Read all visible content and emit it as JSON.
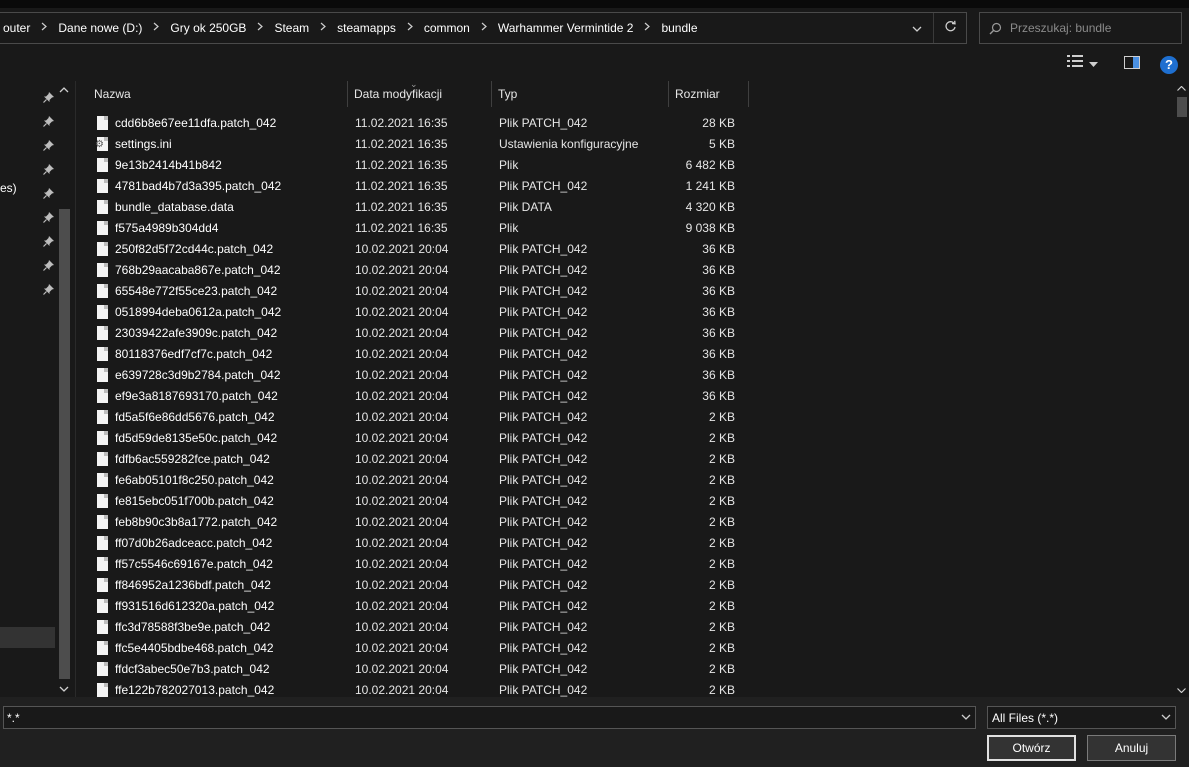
{
  "address": {
    "breadcrumbs": [
      "outer",
      "Dane nowe (D:)",
      "Gry ok 250GB",
      "Steam",
      "steamapps",
      "common",
      "Warhammer Vermintide 2",
      "bundle"
    ]
  },
  "search": {
    "placeholder": "Przeszukaj: bundle"
  },
  "nav": {
    "label_fragment": "es)"
  },
  "columns": {
    "name": "Nazwa",
    "date": "Data modyfikacji",
    "type": "Typ",
    "size": "Rozmiar"
  },
  "files": [
    {
      "name": "cdd6b8e67ee11dfa.patch_042",
      "date": "11.02.2021 16:35",
      "type": "Plik PATCH_042",
      "size": "28 KB",
      "icon": "file-icon"
    },
    {
      "name": "settings.ini",
      "date": "11.02.2021 16:35",
      "type": "Ustawienia konfiguracyjne",
      "size": "5 KB",
      "icon": "settings-file-icon"
    },
    {
      "name": "9e13b2414b41b842",
      "date": "11.02.2021 16:35",
      "type": "Plik",
      "size": "6 482 KB",
      "icon": "file-icon"
    },
    {
      "name": "4781bad4b7d3a395.patch_042",
      "date": "11.02.2021 16:35",
      "type": "Plik PATCH_042",
      "size": "1 241 KB",
      "icon": "file-icon"
    },
    {
      "name": "bundle_database.data",
      "date": "11.02.2021 16:35",
      "type": "Plik DATA",
      "size": "4 320 KB",
      "icon": "file-icon"
    },
    {
      "name": "f575a4989b304dd4",
      "date": "11.02.2021 16:35",
      "type": "Plik",
      "size": "9 038 KB",
      "icon": "file-icon"
    },
    {
      "name": "250f82d5f72cd44c.patch_042",
      "date": "10.02.2021 20:04",
      "type": "Plik PATCH_042",
      "size": "36 KB",
      "icon": "file-icon"
    },
    {
      "name": "768b29aacaba867e.patch_042",
      "date": "10.02.2021 20:04",
      "type": "Plik PATCH_042",
      "size": "36 KB",
      "icon": "file-icon"
    },
    {
      "name": "65548e772f55ce23.patch_042",
      "date": "10.02.2021 20:04",
      "type": "Plik PATCH_042",
      "size": "36 KB",
      "icon": "file-icon"
    },
    {
      "name": "0518994deba0612a.patch_042",
      "date": "10.02.2021 20:04",
      "type": "Plik PATCH_042",
      "size": "36 KB",
      "icon": "file-icon"
    },
    {
      "name": "23039422afe3909c.patch_042",
      "date": "10.02.2021 20:04",
      "type": "Plik PATCH_042",
      "size": "36 KB",
      "icon": "file-icon"
    },
    {
      "name": "80118376edf7cf7c.patch_042",
      "date": "10.02.2021 20:04",
      "type": "Plik PATCH_042",
      "size": "36 KB",
      "icon": "file-icon"
    },
    {
      "name": "e639728c3d9b2784.patch_042",
      "date": "10.02.2021 20:04",
      "type": "Plik PATCH_042",
      "size": "36 KB",
      "icon": "file-icon"
    },
    {
      "name": "ef9e3a8187693170.patch_042",
      "date": "10.02.2021 20:04",
      "type": "Plik PATCH_042",
      "size": "36 KB",
      "icon": "file-icon"
    },
    {
      "name": "fd5a5f6e86dd5676.patch_042",
      "date": "10.02.2021 20:04",
      "type": "Plik PATCH_042",
      "size": "2 KB",
      "icon": "file-icon"
    },
    {
      "name": "fd5d59de8135e50c.patch_042",
      "date": "10.02.2021 20:04",
      "type": "Plik PATCH_042",
      "size": "2 KB",
      "icon": "file-icon"
    },
    {
      "name": "fdfb6ac559282fce.patch_042",
      "date": "10.02.2021 20:04",
      "type": "Plik PATCH_042",
      "size": "2 KB",
      "icon": "file-icon"
    },
    {
      "name": "fe6ab05101f8c250.patch_042",
      "date": "10.02.2021 20:04",
      "type": "Plik PATCH_042",
      "size": "2 KB",
      "icon": "file-icon"
    },
    {
      "name": "fe815ebc051f700b.patch_042",
      "date": "10.02.2021 20:04",
      "type": "Plik PATCH_042",
      "size": "2 KB",
      "icon": "file-icon"
    },
    {
      "name": "feb8b90c3b8a1772.patch_042",
      "date": "10.02.2021 20:04",
      "type": "Plik PATCH_042",
      "size": "2 KB",
      "icon": "file-icon"
    },
    {
      "name": "ff07d0b26adceacc.patch_042",
      "date": "10.02.2021 20:04",
      "type": "Plik PATCH_042",
      "size": "2 KB",
      "icon": "file-icon"
    },
    {
      "name": "ff57c5546c69167e.patch_042",
      "date": "10.02.2021 20:04",
      "type": "Plik PATCH_042",
      "size": "2 KB",
      "icon": "file-icon"
    },
    {
      "name": "ff846952a1236bdf.patch_042",
      "date": "10.02.2021 20:04",
      "type": "Plik PATCH_042",
      "size": "2 KB",
      "icon": "file-icon"
    },
    {
      "name": "ff931516d612320a.patch_042",
      "date": "10.02.2021 20:04",
      "type": "Plik PATCH_042",
      "size": "2 KB",
      "icon": "file-icon"
    },
    {
      "name": "ffc3d78588f3be9e.patch_042",
      "date": "10.02.2021 20:04",
      "type": "Plik PATCH_042",
      "size": "2 KB",
      "icon": "file-icon"
    },
    {
      "name": "ffc5e4405bdbe468.patch_042",
      "date": "10.02.2021 20:04",
      "type": "Plik PATCH_042",
      "size": "2 KB",
      "icon": "file-icon"
    },
    {
      "name": "ffdcf3abec50e7b3.patch_042",
      "date": "10.02.2021 20:04",
      "type": "Plik PATCH_042",
      "size": "2 KB",
      "icon": "file-icon"
    },
    {
      "name": "ffe122b782027013.patch_042",
      "date": "10.02.2021 20:04",
      "type": "Plik PATCH_042",
      "size": "2 KB",
      "icon": "file-icon"
    }
  ],
  "footer": {
    "filename_value": "*.*",
    "filter_value": "All Files (*.*)",
    "open_label": "Otwórz",
    "cancel_label": "Anuluj"
  },
  "colors": {
    "background": "#191919",
    "accent": "#1e6fd0",
    "text": "#ffffff"
  }
}
